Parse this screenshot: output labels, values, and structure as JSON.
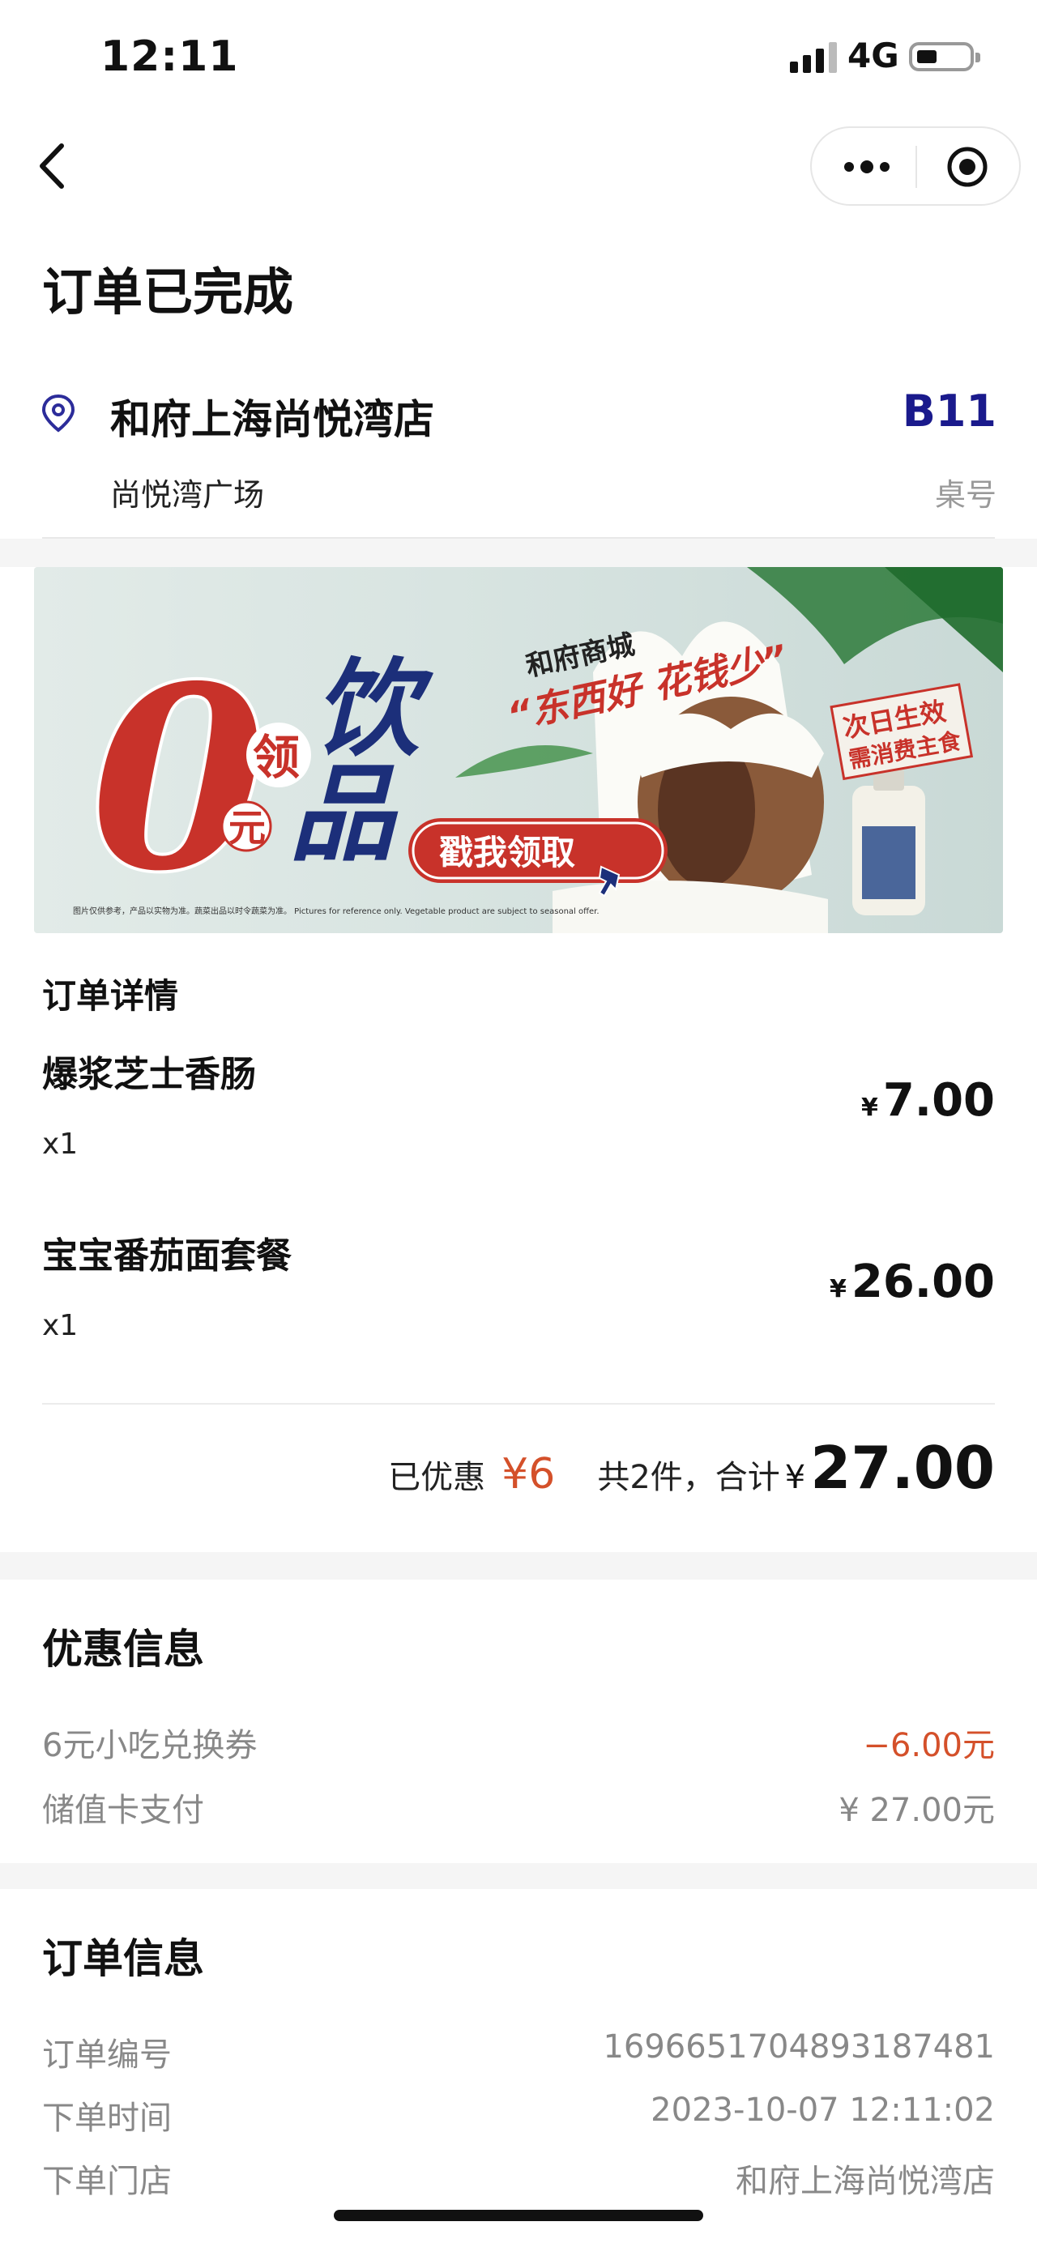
{
  "status_bar": {
    "time": "12:11",
    "network": "4G",
    "battery_level": 0.3
  },
  "header": {
    "order_status": "订单已完成",
    "store_name": "和府上海尚悦湾店",
    "store_area": "尚悦湾广场",
    "table_number": "B11",
    "table_label": "桌号"
  },
  "banner": {
    "big_zero": "0",
    "ling": "领",
    "yuan": "元",
    "yin": "饮",
    "pin": "品",
    "brand_line": "和府商城",
    "slogan": "“东西好 花钱少”",
    "cta": "戳我领取",
    "stamp_line1": "次日生效",
    "stamp_line2": "需消费主食",
    "disclaimer": "图片仅供参考，产品以实物为准。蔬菜出品以时令蔬菜为准。 Pictures for reference only. Vegetable product are subject to seasonal offer."
  },
  "order_details": {
    "title": "订单详情",
    "currency": "¥",
    "items": [
      {
        "name": "爆浆芝士香肠",
        "qty": "x1",
        "price": "7.00"
      },
      {
        "name": "宝宝番茄面套餐",
        "qty": "x1",
        "price": "26.00"
      }
    ],
    "discount_label": "已优惠",
    "discount_value": "¥6",
    "count_total_label": "共2件，合计",
    "total_symbol": "¥",
    "total_value": "27.00"
  },
  "promo_info": {
    "title": "优惠信息",
    "rows": [
      {
        "label": "6元小吃兑换券",
        "value": "−6.00元"
      },
      {
        "label": "储值卡支付",
        "value": "¥ 27.00元"
      }
    ]
  },
  "order_info": {
    "title": "订单信息",
    "rows": [
      {
        "label": "订单编号",
        "value": "1696651704893187481"
      },
      {
        "label": "下单时间",
        "value": "2023-10-07 12:11:02"
      },
      {
        "label": "下单门店",
        "value": "和府上海尚悦湾店"
      }
    ]
  },
  "colors": {
    "accent_red": "#d4502a",
    "table_blue": "#1a1a8c",
    "banner_red": "#c8322a",
    "banner_navy": "#1c2f7a"
  }
}
